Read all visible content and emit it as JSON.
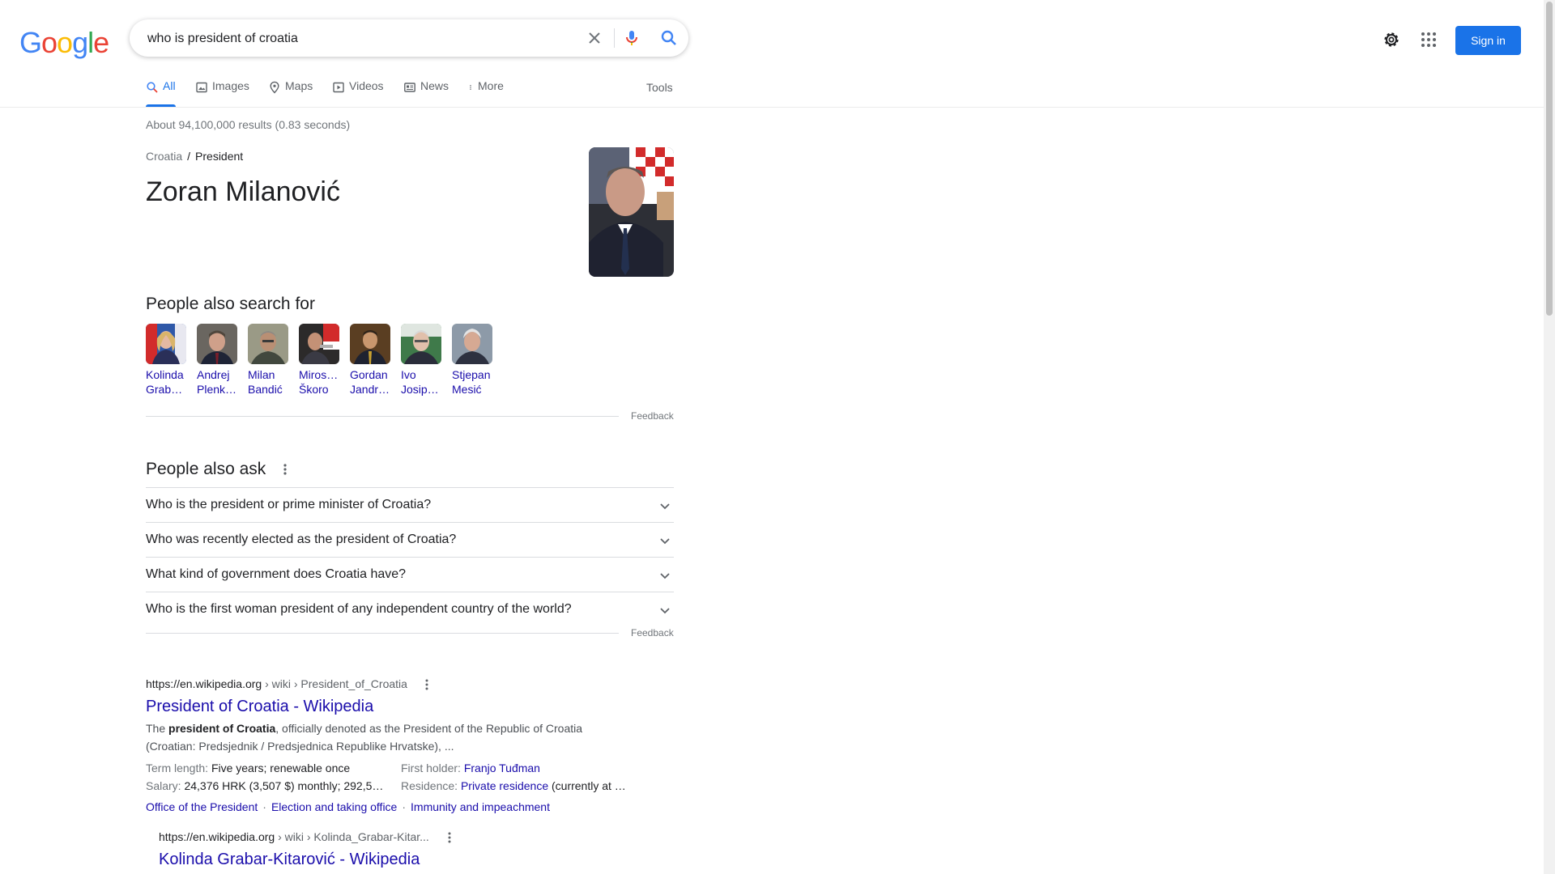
{
  "logo": {
    "text": "Google"
  },
  "search": {
    "query": "who is president of croatia"
  },
  "header": {
    "signin_label": "Sign in"
  },
  "tabs": [
    {
      "label": "All",
      "icon": "search-icon",
      "active": true
    },
    {
      "label": "Images",
      "icon": "image-icon"
    },
    {
      "label": "Maps",
      "icon": "map-pin-icon"
    },
    {
      "label": "Videos",
      "icon": "play-icon"
    },
    {
      "label": "News",
      "icon": "news-icon"
    },
    {
      "label": "More",
      "icon": "more-vert-icon"
    }
  ],
  "tools_label": "Tools",
  "result_stats": "About 94,100,000 results (0.83 seconds)",
  "answer": {
    "breadcrumb": [
      "Croatia",
      "President"
    ],
    "title": "Zoran Milanović"
  },
  "people_also_search": {
    "heading": "People also search for",
    "people": [
      {
        "line1": "Kolinda",
        "line2": "Grab…"
      },
      {
        "line1": "Andrej",
        "line2": "Plenk…"
      },
      {
        "line1": "Milan",
        "line2": "Bandić"
      },
      {
        "line1": "Miros…",
        "line2": "Škoro"
      },
      {
        "line1": "Gordan",
        "line2": "Jandr…"
      },
      {
        "line1": "Ivo",
        "line2": "Josip…"
      },
      {
        "line1": "Stjepan",
        "line2": "Mesić"
      }
    ],
    "feedback": "Feedback"
  },
  "people_also_ask": {
    "heading": "People also ask",
    "questions": [
      "Who is the president or prime minister of Croatia?",
      "Who was recently elected as the president of Croatia?",
      "What kind of government does Croatia have?",
      "Who is the first woman president of any independent country of the world?"
    ],
    "feedback": "Feedback"
  },
  "results": [
    {
      "cite_domain": "https://en.wikipedia.org",
      "cite_path": " › wiki › President_of_Croatia",
      "title": "President of Croatia - Wikipedia",
      "snippet_pre": "The ",
      "snippet_bold": "president of Croatia",
      "snippet_post": ", officially denoted as the President of the Republic of Croatia (Croatian: Predsjednik / Predsjednica Republike Hrvatske), ...",
      "attributes": [
        {
          "label": "Term length: ",
          "value": "Five years; renewable once"
        },
        {
          "label": "First holder: ",
          "link": "Franjo Tuđman"
        },
        {
          "label": "Salary: ",
          "value": "24,376 HRK (3,507 $) monthly; 292,5…"
        },
        {
          "label": "Residence: ",
          "link": "Private residence",
          "value": " (currently at …"
        }
      ],
      "sitelinks": [
        "Office of the President",
        "Election and taking office",
        "Immunity and impeachment"
      ]
    },
    {
      "cite_domain": "https://en.wikipedia.org",
      "cite_path": " › wiki › Kolinda_Grabar-Kitar...",
      "title": "Kolinda Grabar-Kitarović - Wikipedia"
    }
  ],
  "colors": {
    "accent": "#1a73e8",
    "link": "#1a0dab",
    "visited": "#681da8"
  }
}
